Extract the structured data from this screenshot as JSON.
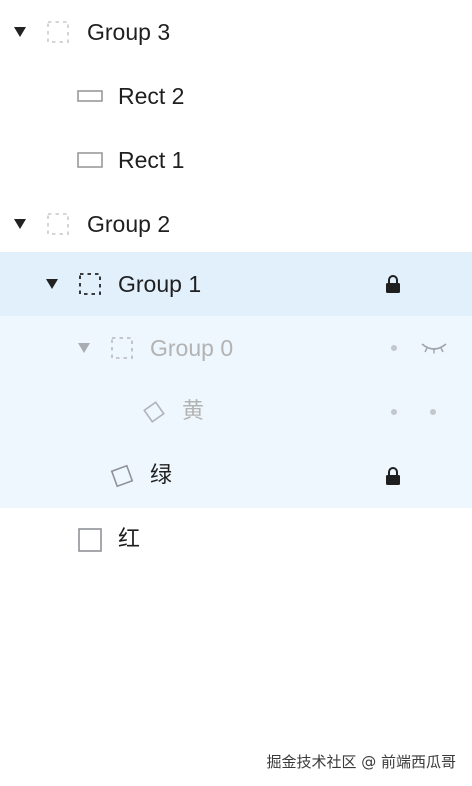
{
  "layers": {
    "group3": {
      "label": "Group 3",
      "expanded": true,
      "icon": "group-dashed-icon"
    },
    "rect2": {
      "label": "Rect 2",
      "icon": "rectangle-icon"
    },
    "rect1": {
      "label": "Rect 1",
      "icon": "rectangle-icon"
    },
    "group2": {
      "label": "Group 2",
      "expanded": true,
      "icon": "group-dashed-icon"
    },
    "group1": {
      "label": "Group 1",
      "expanded": true,
      "selected": true,
      "locked": true,
      "icon": "group-dashed-icon"
    },
    "group0": {
      "label": "Group 0",
      "expanded": true,
      "hidden": true,
      "icon": "group-dashed-icon"
    },
    "yellow": {
      "label": "黄",
      "hidden": true,
      "icon": "rotated-square-icon"
    },
    "green": {
      "label": "绿",
      "locked": true,
      "icon": "rotated-square-icon"
    },
    "red": {
      "label": "红",
      "icon": "square-icon"
    }
  },
  "colors": {
    "selected_row": "#e2f0fc",
    "child_row": "#eef7fe",
    "text": "#1f1f1f",
    "dimmed_text": "#b3b3b3"
  },
  "watermark": "掘金技术社区 @ 前端西瓜哥"
}
